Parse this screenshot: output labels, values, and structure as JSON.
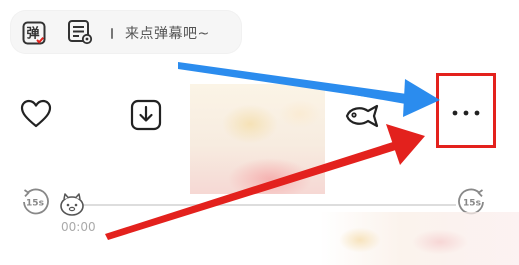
{
  "danmaku": {
    "toggle_glyph": "弹",
    "input_placeholder": "来点弹幕吧~"
  },
  "actions": {
    "like_icon": "heart-outline-icon",
    "download_icon": "download-icon",
    "fish_icon": "fish-icon",
    "more_icon": "more-dots-icon"
  },
  "progress": {
    "rewind_label": "15s",
    "forward_label": "15s",
    "current_time": "00:00",
    "fraction": 0.0
  },
  "annotations": {
    "highlight_color": "#e3211d",
    "blue_arrow_color": "#2b8cee",
    "red_arrow_color": "#e3211d"
  }
}
